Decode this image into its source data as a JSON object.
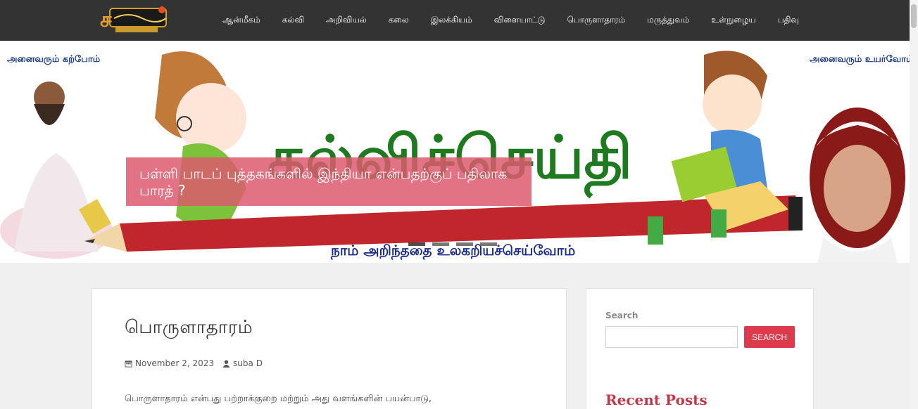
{
  "colors": {
    "nav_bg": "#333333",
    "accent": "#dd3b4c",
    "caption_bg": "#dd5a6e",
    "page_bg": "#f0f0f0"
  },
  "logo": {
    "icon": "site-logo-icon"
  },
  "nav": {
    "items": [
      {
        "label": "ஆன்மீகம்"
      },
      {
        "label": "கல்வி"
      },
      {
        "label": "அறிவியல்"
      },
      {
        "label": "கலை"
      },
      {
        "label": "இலக்கியம்"
      },
      {
        "label": "விளையாட்டு"
      },
      {
        "label": "பொருளாதாரம்"
      },
      {
        "label": "மருத்துவம்"
      },
      {
        "label": "உள்நுழைய"
      },
      {
        "label": "பதிவு"
      }
    ]
  },
  "hero": {
    "banner_title": "கல்விச்செய்தி",
    "banner_tagline": "நாம் அறிந்ததை உலகறியச்செய்வோம்",
    "left_corner_text": "அனைவரும் கற்போம்",
    "right_corner_text": "அனைவரும் உயர்வோம்",
    "caption": "பள்ளி பாடப் புத்தகங்களில் இந்தியா என்பதற்குப் பதிலாக பாரத் ?",
    "slides": 4,
    "active_slide": 1
  },
  "article": {
    "title": "பொருளாதாரம்",
    "date": "November 2, 2023",
    "author": "suba D",
    "date_icon": "calendar-icon",
    "author_icon": "user-icon",
    "excerpt": "பொருளாதாரம் என்பது பற்றாக்குறை மற்றும் அது வளங்களின் பயன்பாடு,"
  },
  "sidebar": {
    "search_label": "Search",
    "search_placeholder": "",
    "search_button": "SEARCH",
    "recent_posts_title": "Recent Posts"
  }
}
